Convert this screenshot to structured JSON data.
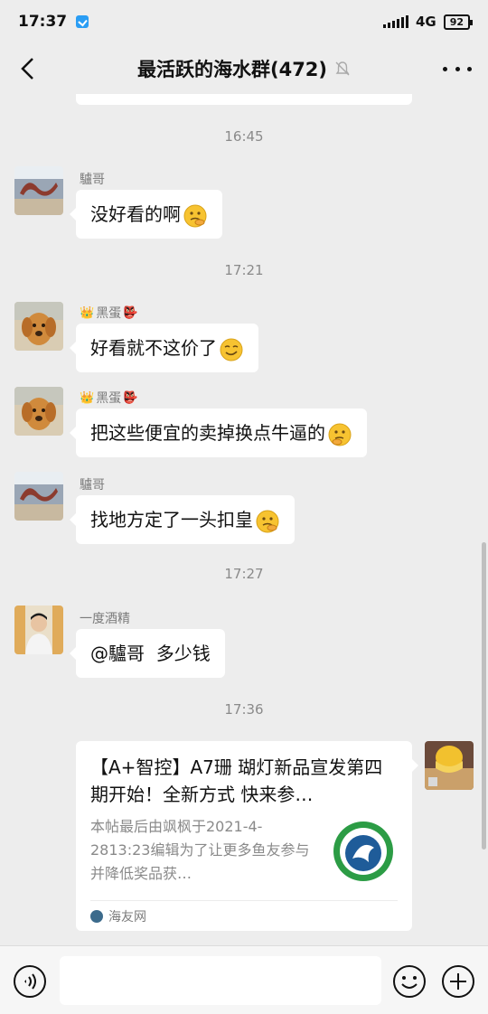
{
  "status_bar": {
    "time": "17:37",
    "network": "4G",
    "battery": "92"
  },
  "nav": {
    "title": "最活跃的海水群(472)"
  },
  "messages": [
    {
      "type": "time",
      "text": "16:45"
    },
    {
      "type": "text",
      "sender": "驢哥",
      "text": "没好看的啊",
      "emoji": "thinking-face"
    },
    {
      "type": "time",
      "text": "17:21"
    },
    {
      "type": "text",
      "sender": "黑蛋",
      "sender_prefix": "👑",
      "sender_suffix": "👺",
      "text": "好看就不这价了",
      "emoji": "smirk-face"
    },
    {
      "type": "text",
      "sender": "黑蛋",
      "sender_prefix": "👑",
      "sender_suffix": "👺",
      "text": "把这些便宜的卖掉换点牛逼的",
      "emoji": "thinking-face"
    },
    {
      "type": "text",
      "sender": "驢哥",
      "text": "找地方定了一头扣皇",
      "emoji": "thinking-face"
    },
    {
      "type": "time",
      "text": "17:27"
    },
    {
      "type": "text",
      "sender": "一度酒精",
      "text": "@驢哥  多少钱"
    },
    {
      "type": "time",
      "text": "17:36"
    }
  ],
  "card": {
    "title": "【A+智控】A7珊 瑚灯新品宣发第四期开始！全新方式  快来参…",
    "description": "本帖最后由飒枫于2021-4-2813:23编辑为了让更多鱼友参与并降低奖品获…",
    "source": "海友网"
  },
  "input": {
    "placeholder": ""
  },
  "colors": {
    "background": "#ededed",
    "bubble": "#ffffff",
    "time_text": "#8a8a8a"
  }
}
